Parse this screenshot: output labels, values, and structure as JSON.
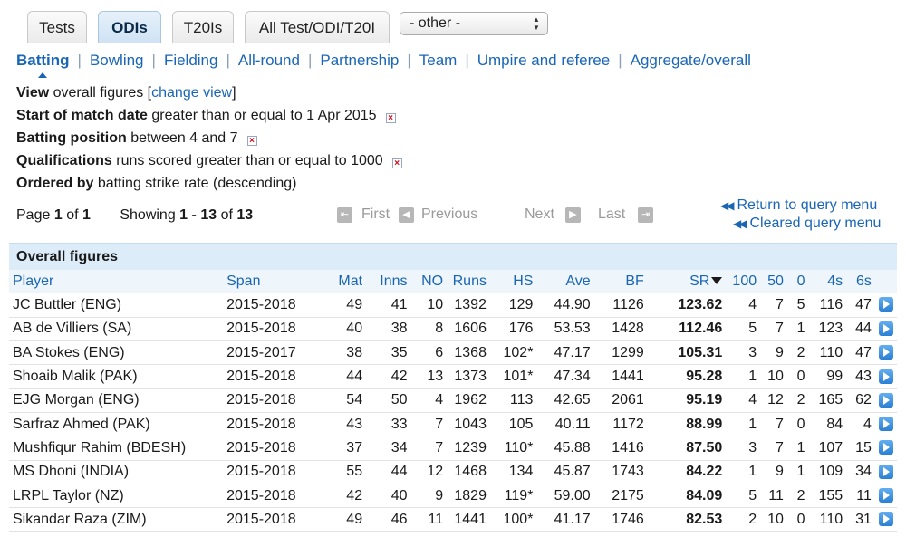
{
  "tabs": [
    {
      "label": "Tests",
      "active": false
    },
    {
      "label": "ODIs",
      "active": true
    },
    {
      "label": "T20Is",
      "active": false
    },
    {
      "label": "All Test/ODI/T20I",
      "active": false
    }
  ],
  "other_select": {
    "value": "- other -"
  },
  "categories": [
    "Batting",
    "Bowling",
    "Fielding",
    "All-round",
    "Partnership",
    "Team",
    "Umpire and referee",
    "Aggregate/overall"
  ],
  "criteria": {
    "view": {
      "label": "View",
      "text": "overall figures [",
      "link": "change view",
      "close": "]"
    },
    "start_date": {
      "label": "Start of match date",
      "text": "greater than or equal to 1 Apr 2015"
    },
    "batting_position": {
      "label": "Batting position",
      "text": "between 4 and 7"
    },
    "qualifications": {
      "label": "Qualifications",
      "text": "runs scored greater than or equal to 1000"
    },
    "ordered_by": {
      "label": "Ordered by",
      "text": "batting strike rate (descending)"
    }
  },
  "pager": {
    "page_label": "Page",
    "page": "1",
    "of_label": "of",
    "pages": "1",
    "showing_label": "Showing",
    "from": "1",
    "to": "13",
    "total": "13",
    "first": "First",
    "previous": "Previous",
    "next": "Next",
    "last": "Last"
  },
  "query_links": {
    "return": "Return to query menu",
    "cleared": "Cleared query menu"
  },
  "table": {
    "title": "Overall figures",
    "headers": [
      "Player",
      "Span",
      "Mat",
      "Inns",
      "NO",
      "Runs",
      "HS",
      "Ave",
      "BF",
      "SR",
      "100",
      "50",
      "0",
      "4s",
      "6s"
    ],
    "rows": [
      [
        "JC Buttler (ENG)",
        "2015-2018",
        "49",
        "41",
        "10",
        "1392",
        "129",
        "44.90",
        "1126",
        "123.62",
        "4",
        "7",
        "5",
        "116",
        "47"
      ],
      [
        "AB de Villiers (SA)",
        "2015-2018",
        "40",
        "38",
        "8",
        "1606",
        "176",
        "53.53",
        "1428",
        "112.46",
        "5",
        "7",
        "1",
        "123",
        "44"
      ],
      [
        "BA Stokes (ENG)",
        "2015-2017",
        "38",
        "35",
        "6",
        "1368",
        "102*",
        "47.17",
        "1299",
        "105.31",
        "3",
        "9",
        "2",
        "110",
        "47"
      ],
      [
        "Shoaib Malik (PAK)",
        "2015-2018",
        "44",
        "42",
        "13",
        "1373",
        "101*",
        "47.34",
        "1441",
        "95.28",
        "1",
        "10",
        "0",
        "99",
        "43"
      ],
      [
        "EJG Morgan (ENG)",
        "2015-2018",
        "54",
        "50",
        "4",
        "1962",
        "113",
        "42.65",
        "2061",
        "95.19",
        "4",
        "12",
        "2",
        "165",
        "62"
      ],
      [
        "Sarfraz Ahmed (PAK)",
        "2015-2018",
        "43",
        "33",
        "7",
        "1043",
        "105",
        "40.11",
        "1172",
        "88.99",
        "1",
        "7",
        "0",
        "84",
        "4"
      ],
      [
        "Mushfiqur Rahim (BDESH)",
        "2015-2018",
        "37",
        "34",
        "7",
        "1239",
        "110*",
        "45.88",
        "1416",
        "87.50",
        "3",
        "7",
        "1",
        "107",
        "15"
      ],
      [
        "MS Dhoni (INDIA)",
        "2015-2018",
        "55",
        "44",
        "12",
        "1468",
        "134",
        "45.87",
        "1743",
        "84.22",
        "1",
        "9",
        "1",
        "109",
        "34"
      ],
      [
        "LRPL Taylor (NZ)",
        "2015-2018",
        "42",
        "40",
        "9",
        "1829",
        "119*",
        "59.00",
        "2175",
        "84.09",
        "5",
        "11",
        "2",
        "155",
        "11"
      ],
      [
        "Sikandar Raza (ZIM)",
        "2015-2018",
        "49",
        "46",
        "11",
        "1441",
        "100*",
        "41.17",
        "1746",
        "82.53",
        "2",
        "10",
        "0",
        "110",
        "31"
      ]
    ]
  },
  "colors": {
    "link": "#1a66b5",
    "header_bg": "#dcecf8",
    "tab_active": "#cfe2f3"
  }
}
